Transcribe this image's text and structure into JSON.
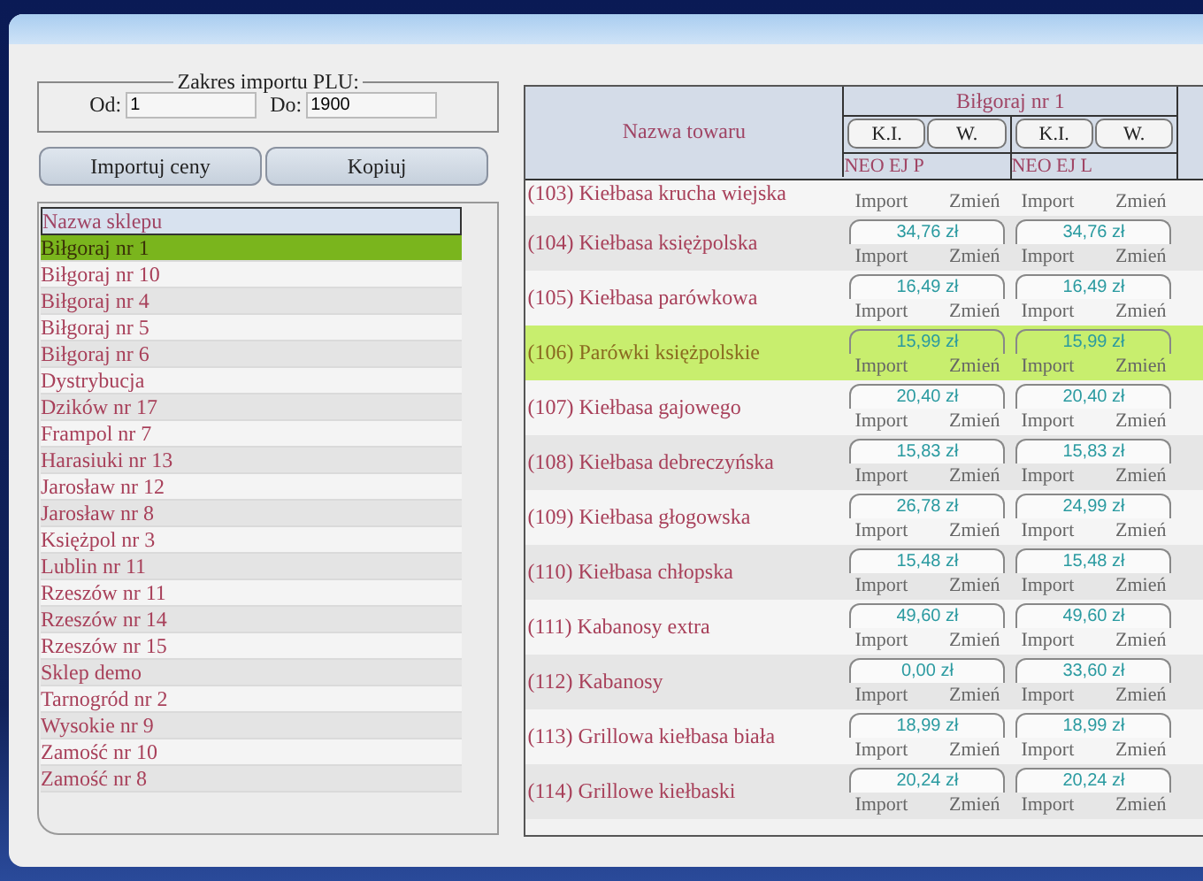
{
  "plu_range": {
    "legend": "Zakres importu PLU:",
    "from_label": "Od:",
    "from_value": "1",
    "to_label": "Do:",
    "to_value": "1900"
  },
  "buttons": [
    "Importuj ceny",
    "Kopiuj"
  ],
  "shops": {
    "header": "Nazwa sklepu",
    "items": [
      {
        "name": "Biłgoraj nr 1",
        "selected": true
      },
      {
        "name": "Biłgoraj nr 10",
        "selected": false
      },
      {
        "name": "Biłgoraj nr 4",
        "selected": false
      },
      {
        "name": "Biłgoraj nr 5",
        "selected": false
      },
      {
        "name": "Biłgoraj nr 6",
        "selected": false
      },
      {
        "name": "Dystrybucja",
        "selected": false
      },
      {
        "name": "Dzików nr 17",
        "selected": false
      },
      {
        "name": "Frampol nr 7",
        "selected": false
      },
      {
        "name": "Harasiuki nr 13",
        "selected": false
      },
      {
        "name": "Jarosław nr 12",
        "selected": false
      },
      {
        "name": "Jarosław nr 8",
        "selected": false
      },
      {
        "name": "Księżpol nr 3",
        "selected": false
      },
      {
        "name": "Lublin nr 11",
        "selected": false
      },
      {
        "name": "Rzeszów nr 11",
        "selected": false
      },
      {
        "name": "Rzeszów nr 14",
        "selected": false
      },
      {
        "name": "Rzeszów nr 15",
        "selected": false
      },
      {
        "name": "Sklep demo",
        "selected": false
      },
      {
        "name": "Tarnogród nr 2",
        "selected": false
      },
      {
        "name": "Wysokie nr 9",
        "selected": false
      },
      {
        "name": "Zamość nr 10",
        "selected": false
      },
      {
        "name": "Zamość nr 8",
        "selected": false
      }
    ]
  },
  "products": {
    "name_header": "Nazwa towaru",
    "store": "Biłgoraj nr 1",
    "sub_columns": [
      {
        "buttons": [
          "K.I.",
          "W."
        ],
        "device": "NEO EJ P"
      },
      {
        "buttons": [
          "K.I.",
          "W."
        ],
        "device": "NEO EJ L"
      }
    ],
    "rows": [
      {
        "name": "(103) Kiełbasa krucha wiejska",
        "selected": false,
        "cells": [
          {
            "import": "Import",
            "change": "Zmień"
          },
          {
            "import": "Import",
            "change": "Zmień"
          }
        ]
      },
      {
        "name": "(104) Kiełbasa księżpolska",
        "selected": false,
        "cells": [
          {
            "price": "34,76 zł",
            "import": "Import",
            "change": "Zmień"
          },
          {
            "price": "34,76 zł",
            "import": "Import",
            "change": "Zmień"
          }
        ]
      },
      {
        "name": "(105) Kiełbasa parówkowa",
        "selected": false,
        "cells": [
          {
            "price": "16,49 zł",
            "import": "Import",
            "change": "Zmień"
          },
          {
            "price": "16,49 zł",
            "import": "Import",
            "change": "Zmień"
          }
        ]
      },
      {
        "name": "(106) Parówki księżpolskie",
        "selected": true,
        "cells": [
          {
            "price": "15,99 zł",
            "import": "Import",
            "change": "Zmień"
          },
          {
            "price": "15,99 zł",
            "import": "Import",
            "change": "Zmień"
          }
        ]
      },
      {
        "name": "(107) Kiełbasa gajowego",
        "selected": false,
        "cells": [
          {
            "price": "20,40 zł",
            "import": "Import",
            "change": "Zmień"
          },
          {
            "price": "20,40 zł",
            "import": "Import",
            "change": "Zmień"
          }
        ]
      },
      {
        "name": "(108) Kiełbasa debreczyńska",
        "selected": false,
        "cells": [
          {
            "price": "15,83 zł",
            "import": "Import",
            "change": "Zmień"
          },
          {
            "price": "15,83 zł",
            "import": "Import",
            "change": "Zmień"
          }
        ]
      },
      {
        "name": "(109) Kiełbasa głogowska",
        "selected": false,
        "cells": [
          {
            "price": "26,78 zł",
            "import": "Import",
            "change": "Zmień"
          },
          {
            "price": "24,99 zł",
            "import": "Import",
            "change": "Zmień"
          }
        ]
      },
      {
        "name": "(110) Kiełbasa chłopska",
        "selected": false,
        "cells": [
          {
            "price": "15,48 zł",
            "import": "Import",
            "change": "Zmień"
          },
          {
            "price": "15,48 zł",
            "import": "Import",
            "change": "Zmień"
          }
        ]
      },
      {
        "name": "(111) Kabanosy extra",
        "selected": false,
        "cells": [
          {
            "price": "49,60 zł",
            "import": "Import",
            "change": "Zmień"
          },
          {
            "price": "49,60 zł",
            "import": "Import",
            "change": "Zmień"
          }
        ]
      },
      {
        "name": "(112) Kabanosy",
        "selected": false,
        "cells": [
          {
            "price": "0,00 zł",
            "import": "Import",
            "change": "Zmień"
          },
          {
            "price": "33,60 zł",
            "import": "Import",
            "change": "Zmień"
          }
        ]
      },
      {
        "name": "(113) Grillowa kiełbasa biała",
        "selected": false,
        "cells": [
          {
            "price": "18,99 zł",
            "import": "Import",
            "change": "Zmień"
          },
          {
            "price": "18,99 zł",
            "import": "Import",
            "change": "Zmień"
          }
        ]
      },
      {
        "name": "(114) Grillowe kiełbaski",
        "selected": false,
        "cells": [
          {
            "price": "20,24 zł",
            "import": "Import",
            "change": "Zmień"
          },
          {
            "price": "20,24 zł",
            "import": "Import",
            "change": "Zmień"
          }
        ]
      }
    ]
  }
}
